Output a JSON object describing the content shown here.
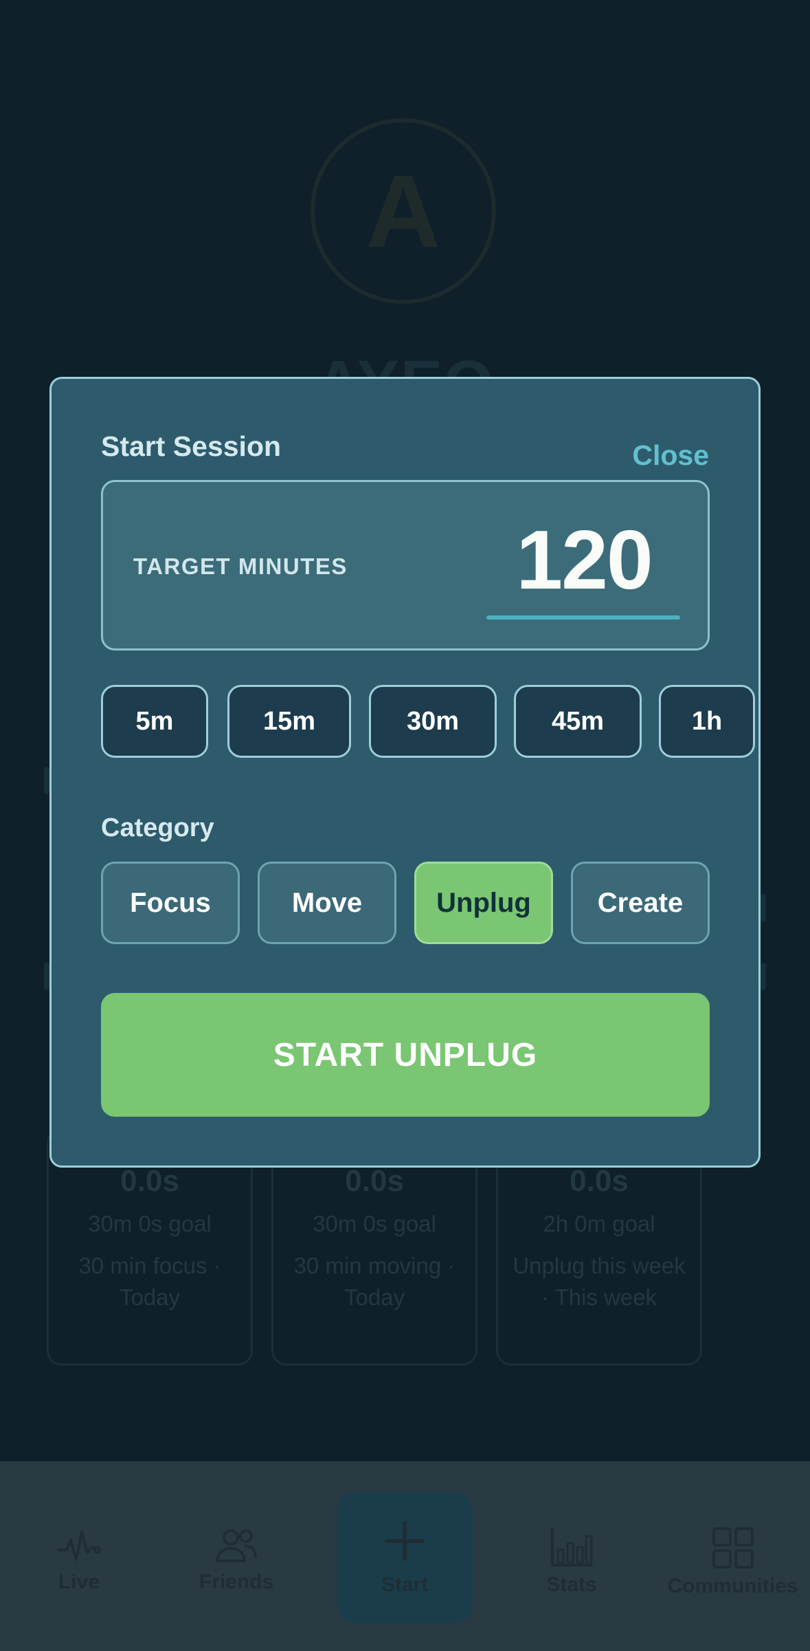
{
  "profile": {
    "avatar_letter": "A",
    "username": "AYEO"
  },
  "goals": [
    {
      "value": "0.0s",
      "goal": "30m 0s goal",
      "description": "30 min focus · Today"
    },
    {
      "value": "0.0s",
      "goal": "30m 0s goal",
      "description": "30 min moving · Today"
    },
    {
      "value": "0.0s",
      "goal": "2h 0m goal",
      "description": "Unplug this week · This week"
    }
  ],
  "modal": {
    "title": "Start Session",
    "close_label": "Close",
    "target_label": "TARGET MINUTES",
    "target_value": "120",
    "presets": [
      "5m",
      "15m",
      "30m",
      "45m",
      "1h"
    ],
    "category_heading": "Category",
    "categories": [
      "Focus",
      "Move",
      "Unplug",
      "Create"
    ],
    "selected_category": "Unplug",
    "start_label": "START UNPLUG"
  },
  "nav": {
    "items": [
      {
        "label": "Live",
        "icon": "pulse-icon"
      },
      {
        "label": "Friends",
        "icon": "friends-icon"
      },
      {
        "label": "Start",
        "icon": "plus-icon"
      },
      {
        "label": "Stats",
        "icon": "bar-chart-icon"
      },
      {
        "label": "Communities",
        "icon": "grid-icon"
      }
    ]
  },
  "colors": {
    "background": "#0f202b",
    "modal": "#2d5b6c",
    "accent_green": "#7ac672",
    "accent_teal": "#62c0cf"
  }
}
